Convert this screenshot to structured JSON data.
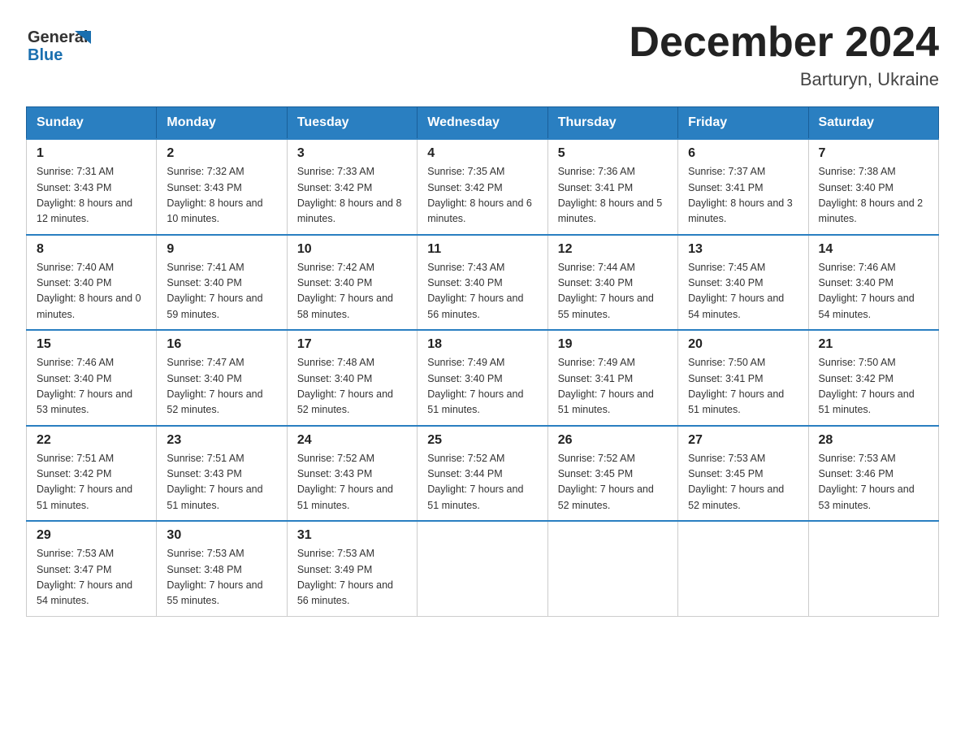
{
  "header": {
    "logo_text_general": "General",
    "logo_text_blue": "Blue",
    "title": "December 2024",
    "subtitle": "Barturyn, Ukraine"
  },
  "weekdays": [
    "Sunday",
    "Monday",
    "Tuesday",
    "Wednesday",
    "Thursday",
    "Friday",
    "Saturday"
  ],
  "weeks": [
    [
      {
        "day": "1",
        "sunrise": "Sunrise: 7:31 AM",
        "sunset": "Sunset: 3:43 PM",
        "daylight": "Daylight: 8 hours and 12 minutes."
      },
      {
        "day": "2",
        "sunrise": "Sunrise: 7:32 AM",
        "sunset": "Sunset: 3:43 PM",
        "daylight": "Daylight: 8 hours and 10 minutes."
      },
      {
        "day": "3",
        "sunrise": "Sunrise: 7:33 AM",
        "sunset": "Sunset: 3:42 PM",
        "daylight": "Daylight: 8 hours and 8 minutes."
      },
      {
        "day": "4",
        "sunrise": "Sunrise: 7:35 AM",
        "sunset": "Sunset: 3:42 PM",
        "daylight": "Daylight: 8 hours and 6 minutes."
      },
      {
        "day": "5",
        "sunrise": "Sunrise: 7:36 AM",
        "sunset": "Sunset: 3:41 PM",
        "daylight": "Daylight: 8 hours and 5 minutes."
      },
      {
        "day": "6",
        "sunrise": "Sunrise: 7:37 AM",
        "sunset": "Sunset: 3:41 PM",
        "daylight": "Daylight: 8 hours and 3 minutes."
      },
      {
        "day": "7",
        "sunrise": "Sunrise: 7:38 AM",
        "sunset": "Sunset: 3:40 PM",
        "daylight": "Daylight: 8 hours and 2 minutes."
      }
    ],
    [
      {
        "day": "8",
        "sunrise": "Sunrise: 7:40 AM",
        "sunset": "Sunset: 3:40 PM",
        "daylight": "Daylight: 8 hours and 0 minutes."
      },
      {
        "day": "9",
        "sunrise": "Sunrise: 7:41 AM",
        "sunset": "Sunset: 3:40 PM",
        "daylight": "Daylight: 7 hours and 59 minutes."
      },
      {
        "day": "10",
        "sunrise": "Sunrise: 7:42 AM",
        "sunset": "Sunset: 3:40 PM",
        "daylight": "Daylight: 7 hours and 58 minutes."
      },
      {
        "day": "11",
        "sunrise": "Sunrise: 7:43 AM",
        "sunset": "Sunset: 3:40 PM",
        "daylight": "Daylight: 7 hours and 56 minutes."
      },
      {
        "day": "12",
        "sunrise": "Sunrise: 7:44 AM",
        "sunset": "Sunset: 3:40 PM",
        "daylight": "Daylight: 7 hours and 55 minutes."
      },
      {
        "day": "13",
        "sunrise": "Sunrise: 7:45 AM",
        "sunset": "Sunset: 3:40 PM",
        "daylight": "Daylight: 7 hours and 54 minutes."
      },
      {
        "day": "14",
        "sunrise": "Sunrise: 7:46 AM",
        "sunset": "Sunset: 3:40 PM",
        "daylight": "Daylight: 7 hours and 54 minutes."
      }
    ],
    [
      {
        "day": "15",
        "sunrise": "Sunrise: 7:46 AM",
        "sunset": "Sunset: 3:40 PM",
        "daylight": "Daylight: 7 hours and 53 minutes."
      },
      {
        "day": "16",
        "sunrise": "Sunrise: 7:47 AM",
        "sunset": "Sunset: 3:40 PM",
        "daylight": "Daylight: 7 hours and 52 minutes."
      },
      {
        "day": "17",
        "sunrise": "Sunrise: 7:48 AM",
        "sunset": "Sunset: 3:40 PM",
        "daylight": "Daylight: 7 hours and 52 minutes."
      },
      {
        "day": "18",
        "sunrise": "Sunrise: 7:49 AM",
        "sunset": "Sunset: 3:40 PM",
        "daylight": "Daylight: 7 hours and 51 minutes."
      },
      {
        "day": "19",
        "sunrise": "Sunrise: 7:49 AM",
        "sunset": "Sunset: 3:41 PM",
        "daylight": "Daylight: 7 hours and 51 minutes."
      },
      {
        "day": "20",
        "sunrise": "Sunrise: 7:50 AM",
        "sunset": "Sunset: 3:41 PM",
        "daylight": "Daylight: 7 hours and 51 minutes."
      },
      {
        "day": "21",
        "sunrise": "Sunrise: 7:50 AM",
        "sunset": "Sunset: 3:42 PM",
        "daylight": "Daylight: 7 hours and 51 minutes."
      }
    ],
    [
      {
        "day": "22",
        "sunrise": "Sunrise: 7:51 AM",
        "sunset": "Sunset: 3:42 PM",
        "daylight": "Daylight: 7 hours and 51 minutes."
      },
      {
        "day": "23",
        "sunrise": "Sunrise: 7:51 AM",
        "sunset": "Sunset: 3:43 PM",
        "daylight": "Daylight: 7 hours and 51 minutes."
      },
      {
        "day": "24",
        "sunrise": "Sunrise: 7:52 AM",
        "sunset": "Sunset: 3:43 PM",
        "daylight": "Daylight: 7 hours and 51 minutes."
      },
      {
        "day": "25",
        "sunrise": "Sunrise: 7:52 AM",
        "sunset": "Sunset: 3:44 PM",
        "daylight": "Daylight: 7 hours and 51 minutes."
      },
      {
        "day": "26",
        "sunrise": "Sunrise: 7:52 AM",
        "sunset": "Sunset: 3:45 PM",
        "daylight": "Daylight: 7 hours and 52 minutes."
      },
      {
        "day": "27",
        "sunrise": "Sunrise: 7:53 AM",
        "sunset": "Sunset: 3:45 PM",
        "daylight": "Daylight: 7 hours and 52 minutes."
      },
      {
        "day": "28",
        "sunrise": "Sunrise: 7:53 AM",
        "sunset": "Sunset: 3:46 PM",
        "daylight": "Daylight: 7 hours and 53 minutes."
      }
    ],
    [
      {
        "day": "29",
        "sunrise": "Sunrise: 7:53 AM",
        "sunset": "Sunset: 3:47 PM",
        "daylight": "Daylight: 7 hours and 54 minutes."
      },
      {
        "day": "30",
        "sunrise": "Sunrise: 7:53 AM",
        "sunset": "Sunset: 3:48 PM",
        "daylight": "Daylight: 7 hours and 55 minutes."
      },
      {
        "day": "31",
        "sunrise": "Sunrise: 7:53 AM",
        "sunset": "Sunset: 3:49 PM",
        "daylight": "Daylight: 7 hours and 56 minutes."
      },
      null,
      null,
      null,
      null
    ]
  ]
}
